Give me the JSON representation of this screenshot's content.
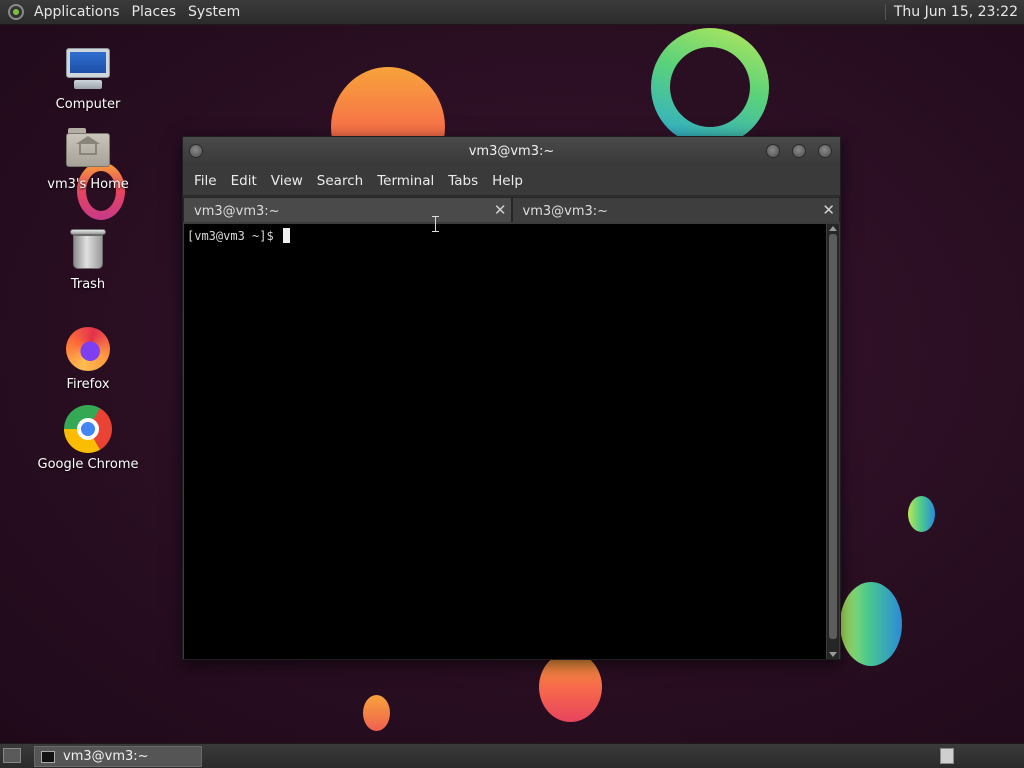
{
  "top_panel": {
    "menus": [
      "Applications",
      "Places",
      "System"
    ],
    "clock": "Thu Jun 15, 23:22"
  },
  "desktop_icons": [
    {
      "label": "Computer",
      "icon": "computer-icon"
    },
    {
      "label": "vm3's Home",
      "icon": "home-folder-icon"
    },
    {
      "label": "Trash",
      "icon": "trash-icon"
    },
    {
      "label": "Firefox",
      "icon": "firefox-icon"
    },
    {
      "label": "Google Chrome",
      "icon": "chrome-icon"
    }
  ],
  "terminal": {
    "title": "vm3@vm3:~",
    "menus": [
      "File",
      "Edit",
      "View",
      "Search",
      "Terminal",
      "Tabs",
      "Help"
    ],
    "tabs": [
      {
        "label": "vm3@vm3:~",
        "active": true
      },
      {
        "label": "vm3@vm3:~",
        "active": false
      }
    ],
    "close_glyph": "✕",
    "prompt": "[vm3@vm3 ~]$ "
  },
  "bottom_panel": {
    "task_label": "vm3@vm3:~"
  }
}
